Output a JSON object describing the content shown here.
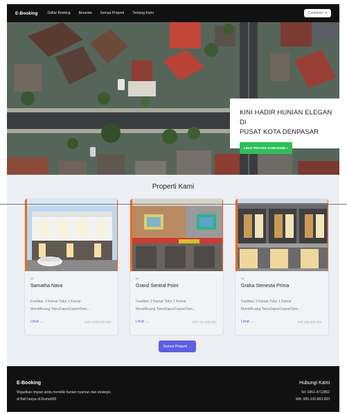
{
  "nav": {
    "brand": "E-Booking",
    "links": [
      "Daftar Booking",
      "Beranda",
      "Semua Properti",
      "Tentang Kami"
    ],
    "customer_label": "Customer",
    "customer_icon": "chevron-down-icon"
  },
  "hero": {
    "title_line1": "KINI HADIR HUNIAN ELEGAN DI",
    "title_line2": "PUSAT KOTA DENPASAR",
    "cta_label": "LIHAT PROYEK KAMI DISINI »"
  },
  "section": {
    "title": "Properti Kami",
    "properties": [
      {
        "id": "#3",
        "name": "Samatha Nava",
        "desc_line1": "Fasilitas: 2 Kamar Tidur 1 Kamar",
        "desc_line2": "MandiRuang TamuDapurCarportTam...",
        "link": "Lihat →",
        "price": "IDR 3.000.000.000"
      },
      {
        "id": "#9",
        "name": "Grand Sentral Point",
        "desc_line1": "Fasilitas: 2 Kamar Tidur 1 Kamar",
        "desc_line2": "MandiRuang TamuDapurCarportTam...",
        "link": "Lihat →",
        "price": "IDR 754.000.000"
      },
      {
        "id": "#5",
        "name": "Graha Semesta Prima",
        "desc_line1": "Fasilitas: 2 Kamar Tidur 1 Kamar",
        "desc_line2": "MandiRuang TamuDapurCarportTam...",
        "link": "Lihat →",
        "price": "IDR 565.000.000"
      }
    ],
    "all_button": "Semua Properti →"
  },
  "footer": {
    "brand": "E-Booking",
    "tagline1": "Wujudkan impian anda memiliki hunian nyaman dan strategis",
    "tagline2": "di Bali hanya di Rumah58",
    "contact_title": "Hubungi Kami",
    "tel": "Tel: 0361-4712862",
    "wa": "WA: 085-100-883-993"
  },
  "colors": {
    "nav_bg": "#111111",
    "cta_green": "#2fbe5b",
    "accent_blue": "#5b5fe0",
    "image_border": "#ef6a1e"
  }
}
